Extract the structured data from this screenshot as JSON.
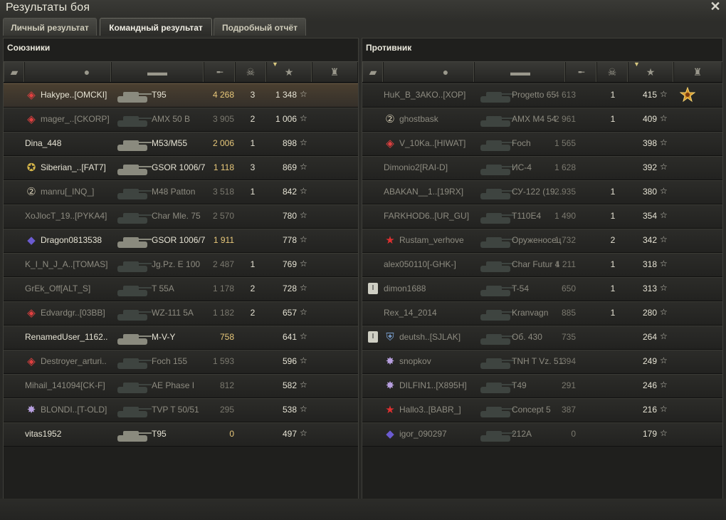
{
  "window": {
    "title": "Результаты боя",
    "close_icon": "close-icon"
  },
  "tabs": [
    {
      "label": "Личный результат",
      "active": false
    },
    {
      "label": "Командный результат",
      "active": true
    },
    {
      "label": "Подробный отчёт",
      "active": false
    }
  ],
  "columns": [
    "platoon-icon",
    "player-icon",
    "tank-icon",
    "damage-icon",
    "kills-icon",
    "xp-star-icon",
    "achievement-icon"
  ],
  "allies": {
    "title": "Союзники",
    "rows": [
      {
        "name": "Hakype..[OMCKI]",
        "medal": "clan-emblem",
        "tank": "T95",
        "dmg": "4 268",
        "kills": "3",
        "xp": "1 348",
        "alive": true,
        "me": true
      },
      {
        "name": "mager_..[CKORP]",
        "medal": "clan-emblem",
        "tank": "AMX 50 B",
        "dmg": "3 905",
        "kills": "2",
        "xp": "1 006",
        "alive": false,
        "me": false
      },
      {
        "name": "Dina_448",
        "medal": "",
        "tank": "M53/M55",
        "dmg": "2 006",
        "kills": "1",
        "xp": "898",
        "alive": true,
        "me": false
      },
      {
        "name": "Siberian_..[FAT7]",
        "medal": "laurel-medal",
        "tank": "GSOR 1006/7",
        "dmg": "1 118",
        "kills": "3",
        "xp": "869",
        "alive": true,
        "me": false
      },
      {
        "name": "manru[_INQ_]",
        "medal": "number-badge",
        "tank": "M48 Patton",
        "dmg": "3 518",
        "kills": "1",
        "xp": "842",
        "alive": false,
        "me": false
      },
      {
        "name": "XoJlocT_19..[PYKA4]",
        "medal": "",
        "tank": "Char Mle. 75",
        "dmg": "2 570",
        "kills": "",
        "xp": "780",
        "alive": false,
        "me": false
      },
      {
        "name": "Dragon0813538",
        "medal": "rank-badge",
        "tank": "GSOR 1006/7",
        "dmg": "1 911",
        "kills": "",
        "xp": "778",
        "alive": true,
        "me": false
      },
      {
        "name": "K_I_N_J_A..[TOMAS]",
        "medal": "",
        "tank": "Jg.Pz. E 100",
        "dmg": "2 487",
        "kills": "1",
        "xp": "769",
        "alive": false,
        "me": false
      },
      {
        "name": "GrEk_Off[ALT_S]",
        "medal": "",
        "tank": "T 55A",
        "dmg": "1 178",
        "kills": "2",
        "xp": "728",
        "alive": false,
        "me": false
      },
      {
        "name": "Edvardgr..[03BB]",
        "medal": "clan-emblem",
        "tank": "WZ-111 5A",
        "dmg": "1 182",
        "kills": "2",
        "xp": "657",
        "alive": false,
        "me": false
      },
      {
        "name": "RenamedUser_1162..",
        "medal": "",
        "tank": "M-V-Y",
        "dmg": "758",
        "kills": "",
        "xp": "641",
        "alive": true,
        "me": false
      },
      {
        "name": "Destroyer_arturi..",
        "medal": "clan-emblem",
        "tank": "Foch 155",
        "dmg": "1 593",
        "kills": "",
        "xp": "596",
        "alive": false,
        "me": false
      },
      {
        "name": "Mihail_141094[CK-F]",
        "medal": "",
        "tank": "AE Phase I",
        "dmg": "812",
        "kills": "",
        "xp": "582",
        "alive": false,
        "me": false
      },
      {
        "name": "BLONDI..[T-OLD]",
        "medal": "star-medal",
        "tank": "TVP T 50/51",
        "dmg": "295",
        "kills": "",
        "xp": "538",
        "alive": false,
        "me": false
      },
      {
        "name": "vitas1952",
        "medal": "",
        "tank": "T95",
        "dmg": "0",
        "kills": "",
        "xp": "497",
        "alive": true,
        "me": false
      }
    ]
  },
  "enemies": {
    "title": "Противник",
    "rows": [
      {
        "name": "HuK_B_3AKO..[XOP]",
        "medal": "",
        "tank": "Progetto 65",
        "dmg": "4 613",
        "kills": "1",
        "xp": "415",
        "alive": false,
        "achv": "gold-medal-icon"
      },
      {
        "name": "ghostbask",
        "medal": "number-badge",
        "tank": "AMX M4 54",
        "dmg": "2 961",
        "kills": "1",
        "xp": "409",
        "alive": false
      },
      {
        "name": "V_10Ka..[HIWAT]",
        "medal": "clan-emblem",
        "tank": "Foch",
        "dmg": "1 565",
        "kills": "",
        "xp": "398",
        "alive": false
      },
      {
        "name": "Dimonio2[RAI-D]",
        "medal": "",
        "tank": "ИС-4",
        "dmg": "1 628",
        "kills": "",
        "xp": "392",
        "alive": false
      },
      {
        "name": "ABAKAN__1..[19RX]",
        "medal": "",
        "tank": "СУ-122 (19...",
        "dmg": "2 935",
        "kills": "1",
        "xp": "380",
        "alive": false
      },
      {
        "name": "FARKHOD6..[UR_GU]",
        "medal": "",
        "tank": "T110E4",
        "dmg": "1 490",
        "kills": "1",
        "xp": "354",
        "alive": false
      },
      {
        "name": "Rustam_verhove",
        "medal": "red-star-medal",
        "tank": "Оруженосец",
        "dmg": "1 732",
        "kills": "2",
        "xp": "342",
        "alive": false
      },
      {
        "name": "alex050110[-GHK-]",
        "medal": "",
        "tank": "Char Futur 4",
        "dmg": "1 211",
        "kills": "1",
        "xp": "318",
        "alive": false
      },
      {
        "name": "dimon1688",
        "medal": "",
        "tank": "T-54",
        "dmg": "650",
        "kills": "1",
        "xp": "313",
        "alive": false,
        "platoon": "platoon-icon"
      },
      {
        "name": "Rex_14_2014",
        "medal": "",
        "tank": "Kranvagn",
        "dmg": "885",
        "kills": "1",
        "xp": "280",
        "alive": false
      },
      {
        "name": "deutsh..[SJLAK]",
        "medal": "shield-medal",
        "tank": "Об. 430",
        "dmg": "735",
        "kills": "",
        "xp": "264",
        "alive": false,
        "platoon": "platoon-icon"
      },
      {
        "name": "snopkov",
        "medal": "star-medal",
        "tank": "TNH T Vz. 51",
        "dmg": "394",
        "kills": "",
        "xp": "249",
        "alive": false
      },
      {
        "name": "DILFIN1..[X895H]",
        "medal": "star-medal",
        "tank": "T49",
        "dmg": "291",
        "kills": "",
        "xp": "246",
        "alive": false
      },
      {
        "name": "Hallo3..[BABR_]",
        "medal": "red-star-medal",
        "tank": "Concept 5",
        "dmg": "387",
        "kills": "",
        "xp": "216",
        "alive": false
      },
      {
        "name": "igor_090297",
        "medal": "rank-badge",
        "tank": "212A",
        "dmg": "0",
        "kills": "",
        "xp": "179",
        "alive": false
      }
    ]
  }
}
